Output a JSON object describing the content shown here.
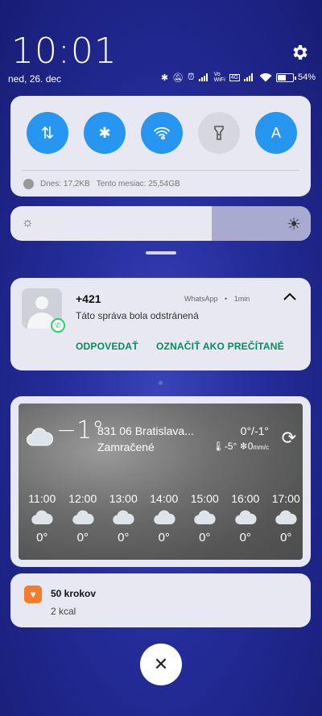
{
  "status": {
    "time": "10:01",
    "date": "ned, 26. dec",
    "battery": "54%",
    "icons": [
      "bluetooth-icon",
      "dnd-icon",
      "alarm-icon",
      "signal-icon",
      "vowifi-icon",
      "volte-icon",
      "signal2-icon",
      "wifi-icon",
      "battery-icon"
    ],
    "vowifi": "Vo WiFi",
    "volte": "4G"
  },
  "quick_settings": {
    "tiles": [
      {
        "name": "mobile-data",
        "icon": "⇅",
        "on": true
      },
      {
        "name": "bluetooth",
        "icon": "✱",
        "on": true
      },
      {
        "name": "wifi",
        "icon": "wifi",
        "on": true
      },
      {
        "name": "flashlight",
        "icon": "flashlight",
        "on": false
      },
      {
        "name": "auto-brightness",
        "icon": "A",
        "on": true
      }
    ],
    "data_today": "Dnes: 17,2KB",
    "data_month": "Tento mesiac: 25,54GB"
  },
  "brightness": {
    "level": 0.67
  },
  "notification": {
    "sender": "+421",
    "app": "WhatsApp",
    "separator": "•",
    "age": "1min",
    "message": "Táto správa bola odstránená",
    "action_reply": "ODPOVEDAŤ",
    "action_read": "OZNAČIŤ AKO PREČÍTANÉ"
  },
  "weather": {
    "temp": "−1°",
    "location": "831 06 Bratislava...",
    "condition": "Zamračené",
    "range": "0°/-1°",
    "feels": "-5°",
    "wind": "0",
    "wind_unit": "mm/c",
    "hours": [
      {
        "time": "11:00",
        "temp": "0°"
      },
      {
        "time": "12:00",
        "temp": "0°"
      },
      {
        "time": "13:00",
        "temp": "0°"
      },
      {
        "time": "14:00",
        "temp": "0°"
      },
      {
        "time": "15:00",
        "temp": "0°"
      },
      {
        "time": "16:00",
        "temp": "0°"
      },
      {
        "time": "17:00",
        "temp": "0°"
      }
    ]
  },
  "steps": {
    "title": "50 krokov",
    "subtitle": "2 kcal"
  },
  "colors": {
    "accent": "#2796f1",
    "action": "#0a8a5c",
    "steps_icon": "#f57c2b"
  }
}
